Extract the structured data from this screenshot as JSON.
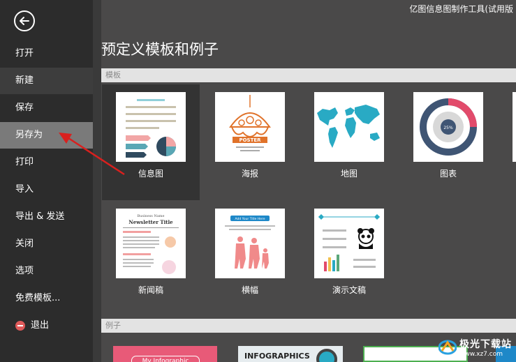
{
  "app": {
    "title": "亿图信息图制作工具(试用版"
  },
  "sidebar": {
    "items": [
      {
        "label": "打开"
      },
      {
        "label": "新建"
      },
      {
        "label": "保存"
      },
      {
        "label": "另存为"
      },
      {
        "label": "打印"
      },
      {
        "label": "导入"
      },
      {
        "label": "导出 & 发送"
      },
      {
        "label": "关闭"
      },
      {
        "label": "选项"
      },
      {
        "label": "免费模板..."
      },
      {
        "label": "退出"
      }
    ]
  },
  "main": {
    "title": "预定义模板和例子",
    "templates_header": "模板",
    "examples_header": "例子",
    "templates": [
      {
        "label": "信息图"
      },
      {
        "label": "海报",
        "thumb_text": "POSTER"
      },
      {
        "label": "地图"
      },
      {
        "label": "图表",
        "thumb_text": "25%"
      },
      {
        "label": "新闻稿",
        "thumb_text": "Newsletter Title",
        "thumb_sub": "Business Name"
      },
      {
        "label": "横幅",
        "thumb_text": "Add Your Title Here"
      },
      {
        "label": "演示文稿"
      }
    ],
    "examples": [
      {
        "text": "My Infographic"
      },
      {
        "text": "INFOGRAPHICS"
      }
    ]
  },
  "watermark": {
    "text": "极光下载站",
    "url": "www.xz7.com"
  },
  "colors": {
    "sidebar": "#2c2c2c",
    "main": "#4a4949",
    "accent_red": "#d9201e",
    "map_blue": "#29aac4",
    "chart_pink": "#e24b6b",
    "chart_navy": "#3f5574"
  }
}
